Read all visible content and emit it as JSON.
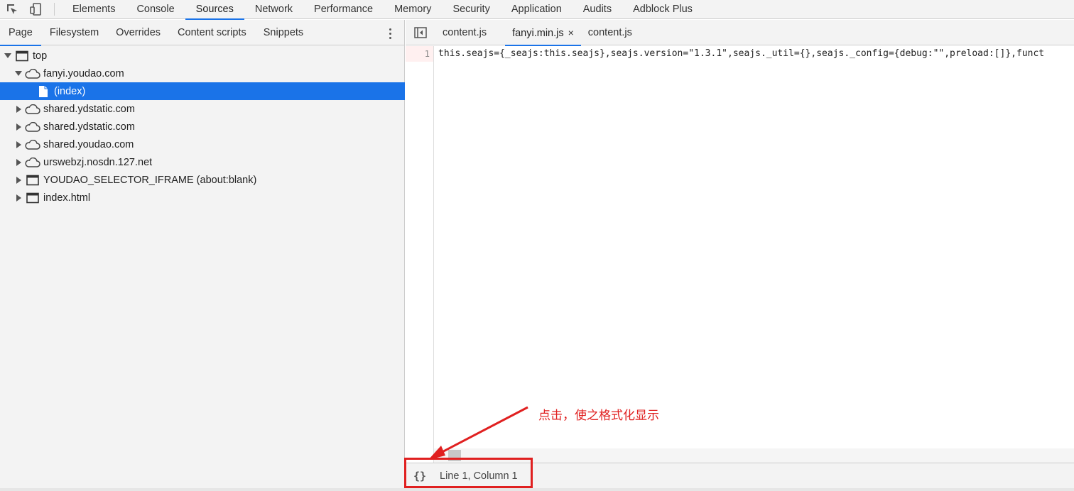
{
  "toolbar": {
    "tabs": [
      {
        "label": "Elements"
      },
      {
        "label": "Console"
      },
      {
        "label": "Sources"
      },
      {
        "label": "Network"
      },
      {
        "label": "Performance"
      },
      {
        "label": "Memory"
      },
      {
        "label": "Security"
      },
      {
        "label": "Application"
      },
      {
        "label": "Audits"
      },
      {
        "label": "Adblock Plus"
      }
    ],
    "active_tab": "Sources"
  },
  "navigator": {
    "tabs": [
      {
        "label": "Page"
      },
      {
        "label": "Filesystem"
      },
      {
        "label": "Overrides"
      },
      {
        "label": "Content scripts"
      },
      {
        "label": "Snippets"
      }
    ],
    "active_tab": "Page",
    "tree": [
      {
        "label": "top",
        "icon": "frame-icon",
        "level": 0,
        "expanded": true
      },
      {
        "label": "fanyi.youdao.com",
        "icon": "cloud-icon",
        "level": 1,
        "expanded": true
      },
      {
        "label": "(index)",
        "icon": "file-icon",
        "level": 2,
        "selected": true
      },
      {
        "label": "shared.ydstatic.com",
        "icon": "cloud-icon",
        "level": 1,
        "expanded": false
      },
      {
        "label": "shared.ydstatic.com",
        "icon": "cloud-icon",
        "level": 1,
        "expanded": false
      },
      {
        "label": "shared.youdao.com",
        "icon": "cloud-icon",
        "level": 1,
        "expanded": false
      },
      {
        "label": "urswebzj.nosdn.127.net",
        "icon": "cloud-icon",
        "level": 1,
        "expanded": false
      },
      {
        "label": "YOUDAO_SELECTOR_IFRAME (about:blank)",
        "icon": "frame-icon",
        "level": 1,
        "expanded": false
      },
      {
        "label": "index.html",
        "icon": "frame-icon",
        "level": 1,
        "expanded": false
      }
    ]
  },
  "editor": {
    "tabs": [
      {
        "label": "content.js"
      },
      {
        "label": "fanyi.min.js",
        "close": "×"
      },
      {
        "label": "content.js"
      }
    ],
    "active_tab": "fanyi.min.js",
    "line_number": "1",
    "code_line": "this.seajs={_seajs:this.seajs},seajs.version=\"1.3.1\",seajs._util={},seajs._config={debug:\"\",preload:[]},funct"
  },
  "status": {
    "pretty_print_label": "{}",
    "cursor_position": "Line 1, Column 1"
  },
  "annotation": {
    "text": "点击，使之格式化显示",
    "color": "#e02020"
  },
  "colors": {
    "accent": "#1a73e8",
    "selection": "#1a73e8",
    "annotation": "#e02020"
  }
}
